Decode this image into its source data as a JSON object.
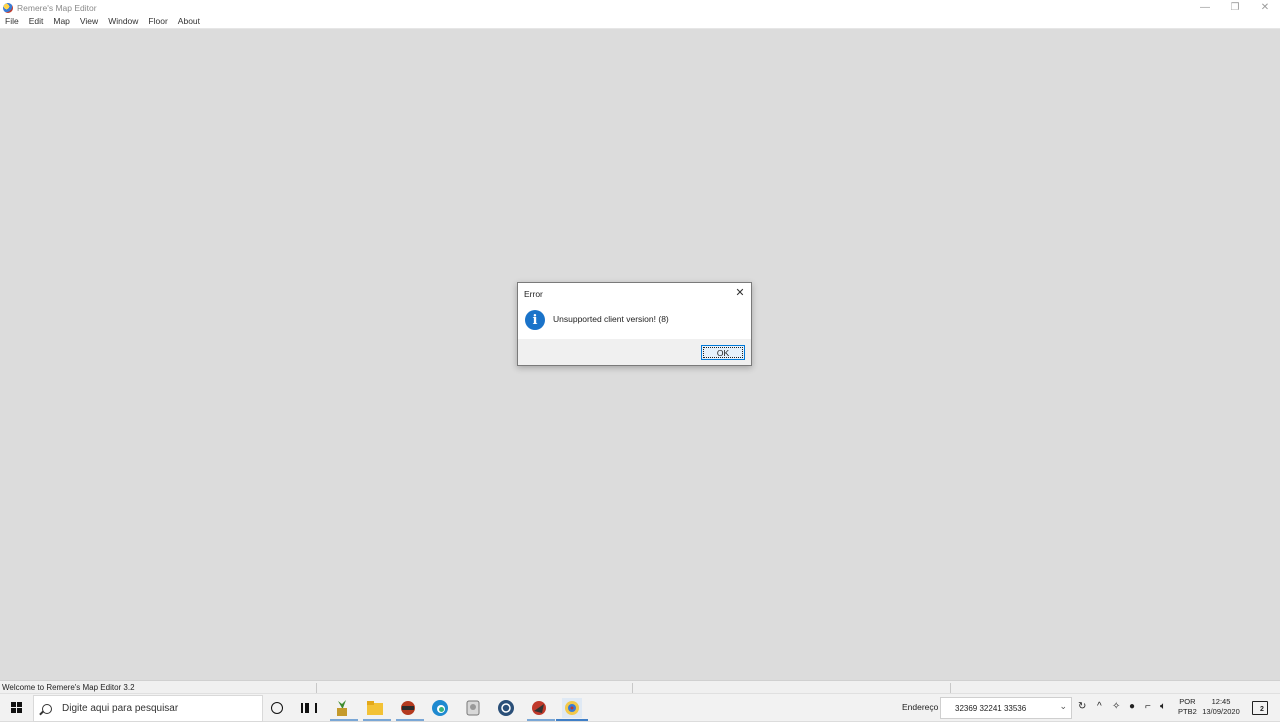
{
  "window": {
    "title": "Remere's Map Editor"
  },
  "menubar": {
    "items": [
      "File",
      "Edit",
      "Map",
      "View",
      "Window",
      "Floor",
      "About"
    ]
  },
  "dialog": {
    "title": "Error",
    "message": "Unsupported client version! (8)",
    "ok_label": "OK",
    "close_glyph": "✕",
    "icon": "info-icon",
    "icon_glyph": "i",
    "icon_color": "#1a73c9"
  },
  "statusbar": {
    "text": "Welcome to Remere's Map Editor 3.2"
  },
  "taskbar": {
    "search_placeholder": "Digite aqui para pesquisar",
    "address_label": "Endereço",
    "address_value": "32369  32241  33536",
    "lang_line1": "POR",
    "lang_line2": "PTB2",
    "time": "12:45",
    "date": "13/09/2020",
    "notification_count": "2",
    "apps": [
      "plant-app-icon",
      "file-explorer-icon",
      "game-client-icon",
      "edge-icon",
      "map-tool-icon",
      "browser-icon",
      "game-launcher-icon",
      "remeres-map-editor-icon"
    ]
  }
}
